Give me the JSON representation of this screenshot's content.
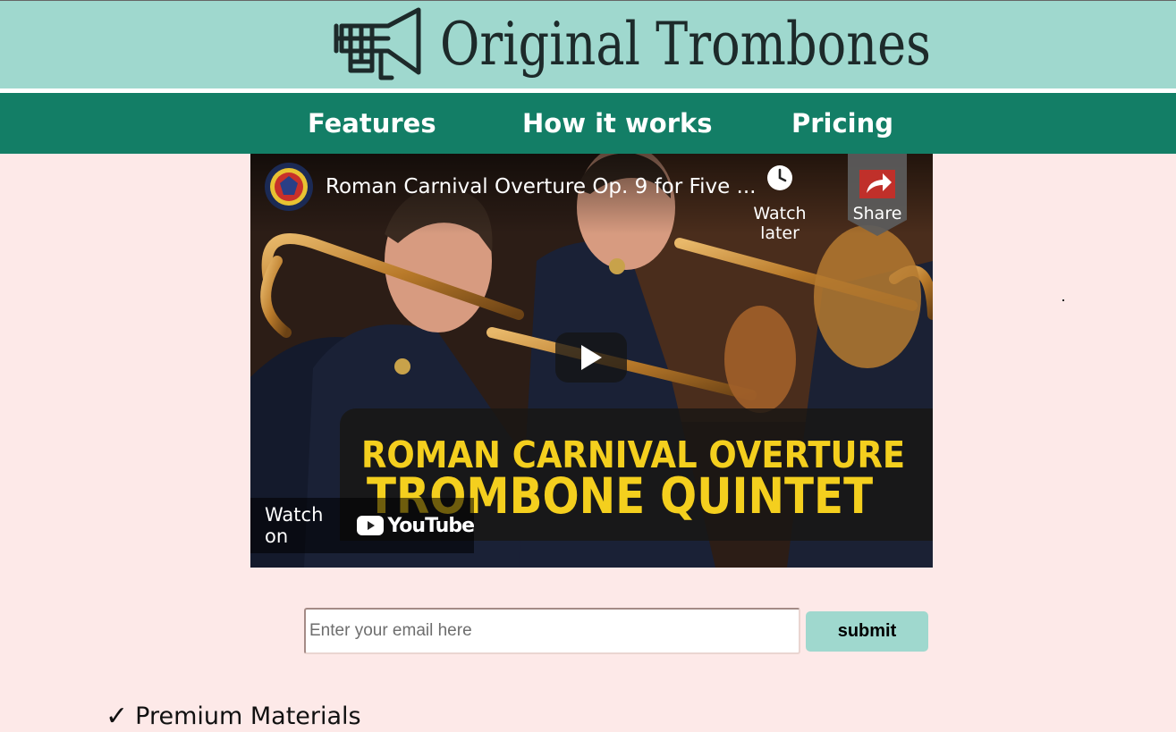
{
  "brand": {
    "name": "Original Trombones",
    "icon": "trumpet-icon"
  },
  "nav": {
    "items": [
      {
        "label": "Features"
      },
      {
        "label": "How it works"
      },
      {
        "label": "Pricing"
      }
    ]
  },
  "video": {
    "title": "Roman Carnival Overture Op. 9 for Five ...",
    "watch_later_label": "Watch later",
    "share_label": "Share",
    "banner_line1": "ROMAN CARNIVAL OVERTURE",
    "banner_line2": "TROMBONE QUINTET",
    "watch_on_label": "Watch on",
    "youtube_label": "YouTube"
  },
  "form": {
    "email_placeholder": "Enter your email here",
    "submit_label": "submit"
  },
  "features": [
    {
      "check": "✓",
      "label": "Premium Materials"
    }
  ],
  "colors": {
    "page_bg": "#fde9e8",
    "header_bg": "#9fd8ce",
    "nav_bg": "#137e66",
    "submit_bg": "#9fd8ce",
    "banner_text": "#f4cf1e"
  }
}
